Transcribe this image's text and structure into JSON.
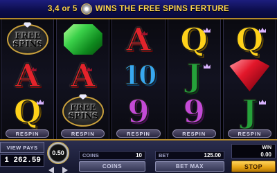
{
  "banner": {
    "text_before": "3,4 or 5",
    "text_after": "WINS THE FREE SPINS FERTURE",
    "icon": "diamond-scatter-icon"
  },
  "reels": [
    {
      "symbols": [
        "free-spins",
        "A",
        "Q"
      ],
      "respin_label": "RESPIN"
    },
    {
      "symbols": [
        "green-gem",
        "A",
        "free-spins"
      ],
      "respin_label": "RESPIN"
    },
    {
      "symbols": [
        "A",
        "10",
        "9"
      ],
      "respin_label": "RESPIN"
    },
    {
      "symbols": [
        "Q",
        "J",
        "9"
      ],
      "respin_label": "RESPIN"
    },
    {
      "symbols": [
        "Q",
        "red-gem",
        "J"
      ],
      "respin_label": "RESPIN"
    }
  ],
  "symbol_text": {
    "A": "A",
    "Q": "Q",
    "J": "J",
    "nine": "9",
    "ten": "10",
    "free_top": "FREE",
    "free_bot": "SPINS"
  },
  "controls": {
    "view_pays": "VIEW PAYS",
    "balance": "1 262.59",
    "coin_size": "0.50",
    "coins_label": "COINS",
    "coins_value": "10",
    "bet_label": "BET",
    "bet_value": "125.00",
    "coins_button": "COINS",
    "bet_max_button": "BET MAX",
    "win_label": "WIN",
    "win_value": "0.00",
    "stop_button": "STOP"
  },
  "colors": {
    "banner_text": "#ffd54a",
    "gold_trim": "#b48a2a",
    "stop_button": "#e6a313"
  }
}
